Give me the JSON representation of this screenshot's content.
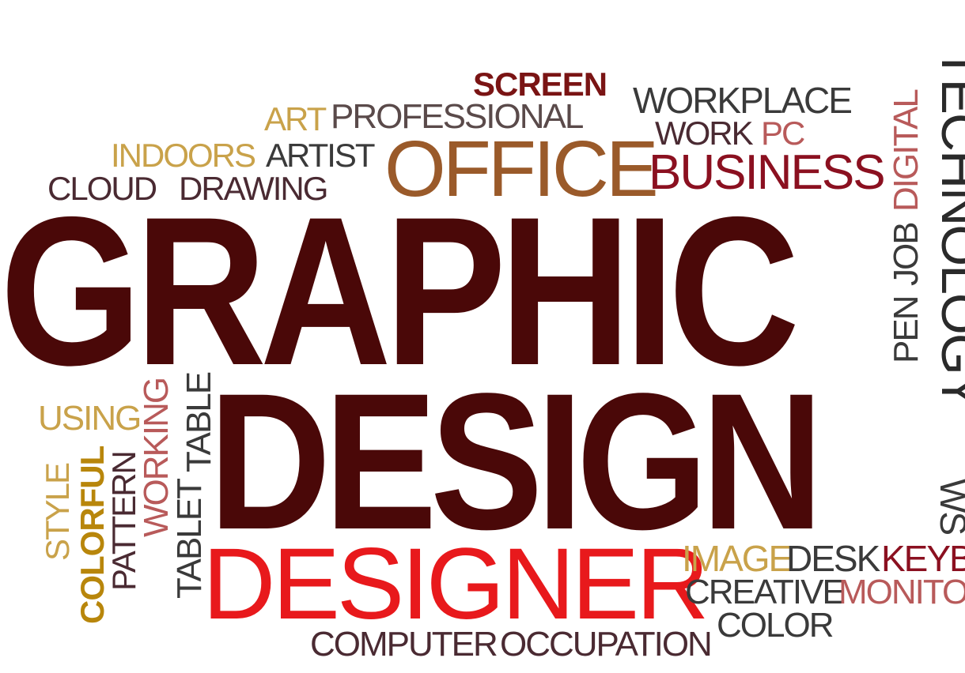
{
  "palette": {
    "dark": "#4a0808",
    "red": "#e8191c",
    "gold": "#c9a24a",
    "ochre": "#b8860b",
    "brown": "#9a5a2a",
    "crimson": "#8b1020",
    "maroon": "#7a1414",
    "rose": "#b85a5a",
    "plum": "#4a2a32",
    "gray": "#3a3a3a"
  },
  "words": {
    "graphic": "GRAPHIC",
    "design": "DESIGN",
    "designer": "DESIGNER",
    "office": "OFFICE",
    "business": "BUSINESS",
    "screen": "SCREEN",
    "workplace": "WORKPLACE",
    "work": "WORK",
    "pc": "PC",
    "art": "ART",
    "professional": "PROFESSIONAL",
    "indoors": "INDOORS",
    "artist": "ARTIST",
    "cloud": "CLOUD",
    "drawing": "DRAWING",
    "technology": "TECHNOLOGY",
    "digital": "DIGITAL",
    "job": "JOB",
    "pen": "PEN",
    "using": "USING",
    "style": "STYLE",
    "colorful": "COLORFUL",
    "pattern": "PATTERN",
    "working": "WORKING",
    "tablet": "TABLET",
    "table": "TABLE",
    "image": "IMAGE",
    "desk": "DESK",
    "keyboard": "KEYB",
    "creative": "CREATIVE",
    "monitor": "MONITO",
    "color": "COLOR",
    "computer": "COMPUTER",
    "occupation": "OCCUPATION",
    "ws_fragment": "WS"
  }
}
